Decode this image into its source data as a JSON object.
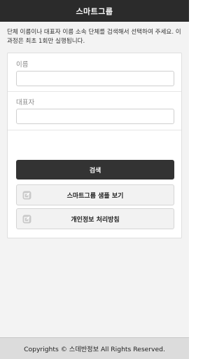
{
  "app": {
    "title": "스마트그룹"
  },
  "intro": {
    "text": "단체 이름이나 대표자 이름 소속 단체를 검색해서 선택하여 주세요. 이 과정은 최초 1회만 실행됩니다."
  },
  "form": {
    "name_label": "이름",
    "name_value": "",
    "representative_label": "대표자",
    "representative_value": "",
    "search_label": "검색"
  },
  "links": [
    {
      "label": "스마트그룹 샘플 보기",
      "icon": "edit-icon"
    },
    {
      "label": "개인정보 처리방침",
      "icon": "edit-icon"
    }
  ],
  "footer": {
    "text": "Copyrights © 스데반정보 All Rights Reserved."
  },
  "colors": {
    "appbar": "#2b2b2b",
    "background": "#f3f3f3",
    "search_button": "#333333",
    "link_button": "#f2f2f2",
    "footer": "#dcdcdc"
  }
}
